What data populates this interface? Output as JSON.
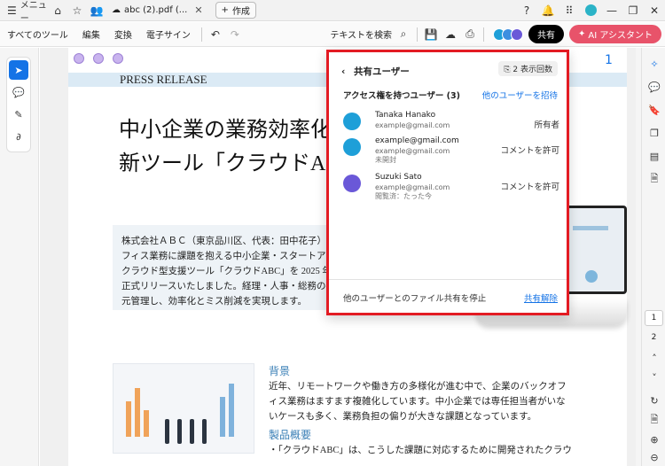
{
  "titlebar": {
    "menu_label": "メニュー",
    "tab_title": "abc (2).pdf (...",
    "new_tab_label": "作成"
  },
  "toolbar": {
    "all_tools": "すべてのツール",
    "edit": "編集",
    "convert": "変換",
    "esign": "電子サイン",
    "search_text": "テキストを検索",
    "share": "共有",
    "ai_assistant": "AI アシスタント"
  },
  "document": {
    "page_number": "1",
    "press_release": "PRESS RELEASE",
    "headline_line1": "中小企業の業務効率化",
    "headline_line2": "新ツール「クラウドA",
    "intro_lines": [
      "株式会社ＡＢＣ（東京品川区、代表：田中花子）は",
      "フィス業務に課題を抱える中小企業・スタートアッ",
      "クラウド型支援ツール「クラウドABC」を 2025 年",
      "正式リリースいたしました。経理・人事・総務の複",
      "元管理し、効率化とミス削減を実現します。"
    ],
    "section1_heading": "背景",
    "section1_lines": [
      "近年、リモートワークや働き方の多様化が進む中で、企業のバックオフ",
      "ィス業務はますます複雑化しています。中小企業では専任担当者がいな",
      "いケースも多く、業務負担の偏りが大きな課題となっています。"
    ],
    "section2_heading": "製品概要",
    "section2_lines": [
      "・「クラウドABC」は、こうした課題に対応するために開発されたクラウ"
    ]
  },
  "share_panel": {
    "title": "共有ユーザー",
    "views_label": "2 表示回数",
    "access_label": "アクセス権を持つユーザー (3)",
    "invite_label": "他のユーザーを招待",
    "users": [
      {
        "name": "Tanaka Hanako",
        "email": "example@gmail.com",
        "status": "",
        "role": "所有者",
        "color": "#1e9fd8"
      },
      {
        "name": "example@gmail.com",
        "email": "example@gmail.com",
        "status": "未開封",
        "role": "コメントを許可",
        "color": "#1e9fd8"
      },
      {
        "name": "Suzuki Sato",
        "email": "example@gmail.com",
        "status": "閲覧済：たった今",
        "role": "コメントを許可",
        "color": "#6a58d8"
      }
    ],
    "stop_sharing_label": "他のユーザーとのファイル共有を停止",
    "unshare_label": "共有解除"
  },
  "right_rail": {
    "page_1": "1",
    "page_2": "2"
  },
  "colors": {
    "accent_blue": "#1473e6",
    "highlight_red": "#e31b23",
    "ai_button": "#e8536a",
    "section_heading": "#3a7fb6"
  }
}
